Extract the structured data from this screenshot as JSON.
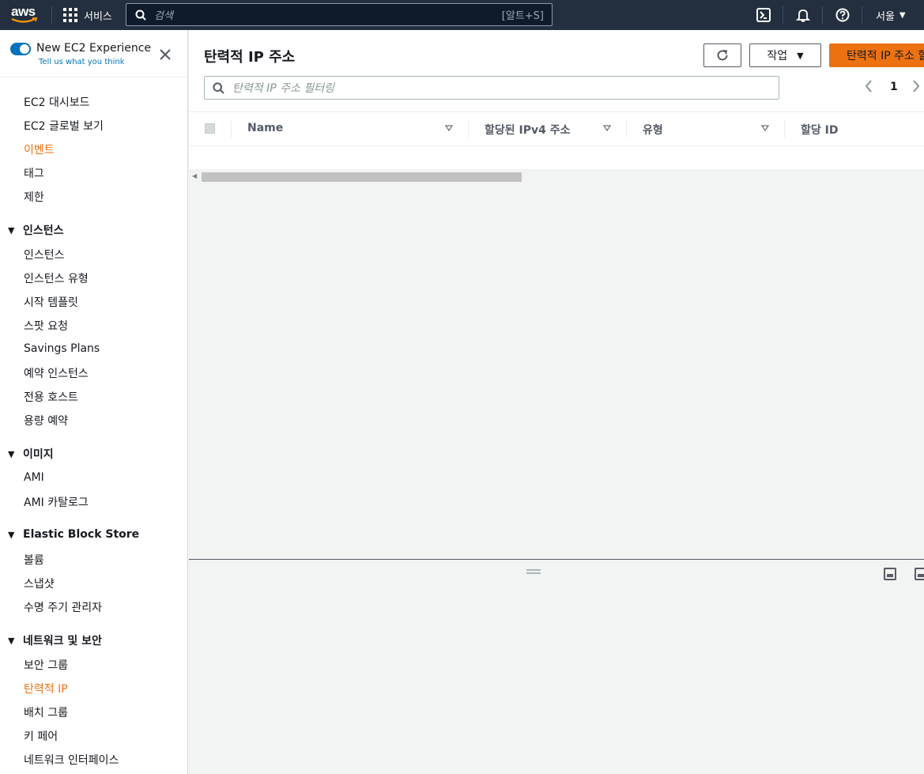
{
  "topnav": {
    "logo_text": "aws",
    "services_label": "서비스",
    "search_placeholder": "검색",
    "search_shortcut": "[알트+S]",
    "region_label": "서울",
    "icons": [
      "cloudshell-icon",
      "bell-icon",
      "help-icon"
    ]
  },
  "sidebar": {
    "experience_title": "New EC2 Experience",
    "experience_link": "Tell us what you think",
    "top_items": [
      "EC2 대시보드",
      "EC2 글로벌 보기",
      "이벤트",
      "태그",
      "제한"
    ],
    "sections": [
      {
        "title": "인스턴스",
        "items": [
          "인스턴스",
          "인스턴스 유형",
          "시작 템플릿",
          "스팟 요청",
          "Savings Plans",
          "예약 인스턴스",
          "전용 호스트",
          "용량 예약"
        ]
      },
      {
        "title": "이미지",
        "items": [
          "AMI",
          "AMI 카탈로그"
        ]
      },
      {
        "title": "Elastic Block Store",
        "items": [
          "볼륨",
          "스냅샷",
          "수명 주기 관리자"
        ]
      },
      {
        "title": "네트워크 및 보안",
        "items": [
          "보안 그룹",
          "탄력적 IP",
          "배치 그룹",
          "키 페어",
          "네트워크 인터페이스"
        ]
      }
    ],
    "active_color": "#ec7211"
  },
  "main": {
    "title": "탄력적 IP 주소",
    "actions_label": "작업",
    "primary_label": "탄력적 IP 주소 할당",
    "filter_placeholder": "탄력적 IP 주소 필터링",
    "page_number": "1",
    "columns": [
      "Name",
      "할당된 IPv4 주소",
      "유형",
      "할당 ID"
    ]
  },
  "colors": {
    "nav_bg": "#232f3e",
    "primary": "#ec7211",
    "link": "#0073bb"
  }
}
